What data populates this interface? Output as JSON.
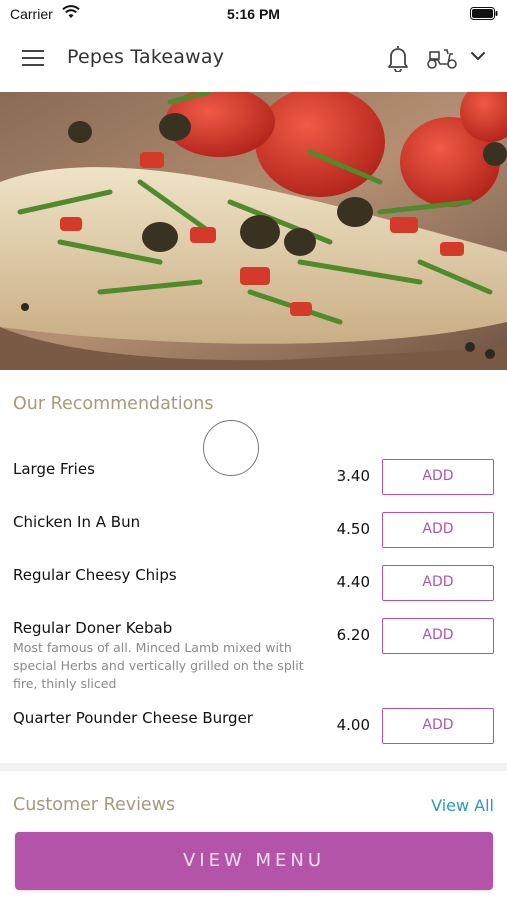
{
  "status_bar": {
    "carrier": "Carrier",
    "time": "5:16 PM"
  },
  "header": {
    "title": "Pepes Takeaway",
    "icons": [
      "menu-icon",
      "bell-icon",
      "delivery-scooter-icon",
      "chevron-down-icon"
    ]
  },
  "hero": {
    "image": "flatbread pizza with tomatoes, olives and rocket"
  },
  "recommendations": {
    "title": "Our Recommendations",
    "items": [
      {
        "name": "Large Fries",
        "description": "",
        "price": "3.40",
        "button": "ADD"
      },
      {
        "name": "Chicken In A Bun",
        "description": "",
        "price": "4.50",
        "button": "ADD"
      },
      {
        "name": "Regular Cheesy Chips",
        "description": "",
        "price": "4.40",
        "button": "ADD"
      },
      {
        "name": "Regular Doner Kebab",
        "description": "Most famous of all. Minced Lamb mixed with special Herbs and vertically grilled on the split fire, thinly sliced",
        "price": "6.20",
        "button": "ADD"
      },
      {
        "name": "Quarter Pounder Cheese Burger",
        "description": "",
        "price": "4.00",
        "button": "ADD"
      }
    ]
  },
  "reviews": {
    "title": "Customer Reviews",
    "view_all": "View All"
  },
  "footer": {
    "view_menu": "VIEW MENU"
  },
  "colors": {
    "accent": "#b454a8",
    "section_title": "#a69a78",
    "link": "#2a9bc1"
  }
}
